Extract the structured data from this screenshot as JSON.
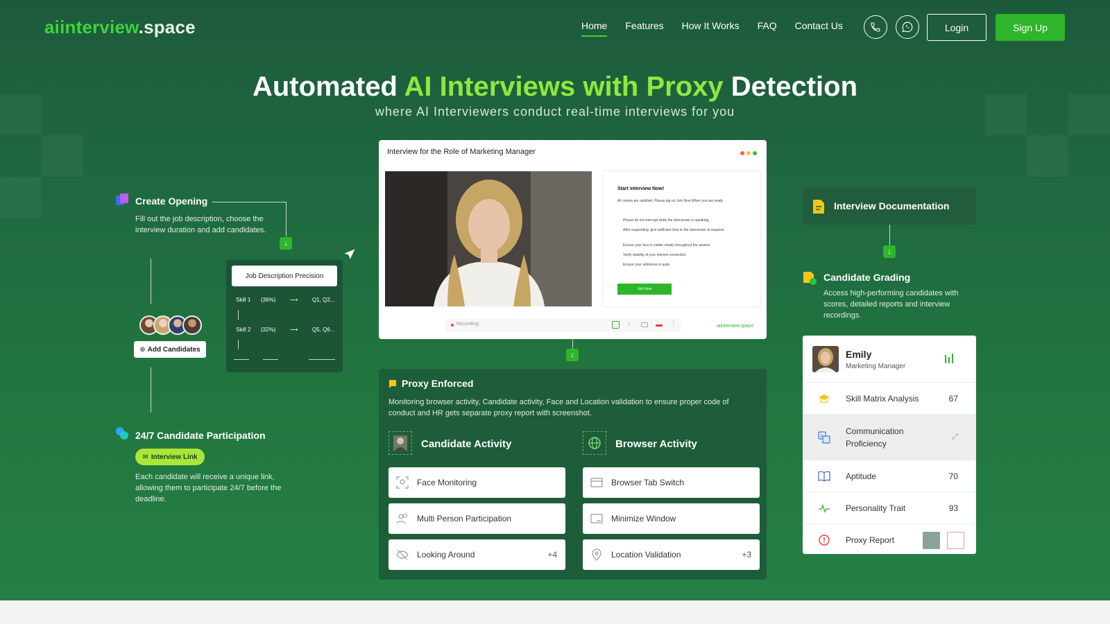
{
  "brand": {
    "logo_part1": "aiinterview",
    "logo_part2": ".space"
  },
  "nav": {
    "items": [
      "Home",
      "Features",
      "How It Works",
      "FAQ",
      "Contact Us"
    ],
    "login": "Login",
    "signup": "Sign Up"
  },
  "hero": {
    "title_part1": "Automated ",
    "title_highlight": "AI Interviews with Proxy",
    "title_part2": " Detection",
    "subtitle": "where AI Interviewers conduct real-time interviews for you"
  },
  "left": {
    "create_opening": {
      "title": "Create Opening",
      "desc": "Fill out the job description, choose the interview duration and add candidates."
    },
    "jd_card": {
      "title": "Job Description Precision",
      "rows": [
        {
          "skill": "Skill 1",
          "pct": "(36%)",
          "qs": "Q1, Q2..."
        },
        {
          "skill": "Skill 2",
          "pct": "(32%)",
          "qs": "Q5, Q6..."
        }
      ]
    },
    "add_candidates": "Add Candidates",
    "participation": {
      "title": "24/7 Candidate Participation",
      "link_label": "Interview Link",
      "desc": "Each candidate will receive a unique link, allowing them to participate 24/7 before the deadline."
    }
  },
  "interview_window": {
    "title": "Interview for the Role of Marketing Manager",
    "panel_title": "Start Interview Now!",
    "panel_intro": "All criteria are satisfied. Please tap on Join Now When you are ready.",
    "checklist": [
      "Please do not interrupt while the interviewer is speaking.",
      "After responding, give sufficient time to the interviewer to respond.",
      "Ensure your face is visible clearly throughout the session",
      "Verify stability of your internet connection",
      "Ensure your ambiance is quite"
    ],
    "join_button": "Join Now",
    "recording": "Recording",
    "watermark": "aiinterview.space"
  },
  "proxy": {
    "title": "Proxy Enforced",
    "desc": "Monitoring browser activity, Candidate activity, Face and Location validation to ensure proper code of conduct and HR gets separate proxy report with screenshot.",
    "candidate_activity": {
      "title": "Candidate Activity",
      "items": [
        {
          "label": "Face Monitoring",
          "count": ""
        },
        {
          "label": "Multi Person Participation",
          "count": ""
        },
        {
          "label": "Looking Around",
          "count": "+4"
        }
      ]
    },
    "browser_activity": {
      "title": "Browser Activity",
      "items": [
        {
          "label": "Browser Tab Switch",
          "count": ""
        },
        {
          "label": "Minimize Window",
          "count": ""
        },
        {
          "label": "Location Validation",
          "count": "+3"
        }
      ]
    }
  },
  "right": {
    "documentation": {
      "title": "Interview Documentation"
    },
    "grading": {
      "title": "Candidate Grading",
      "desc": "Access high-performing candidates with scores, detailed reports and interview recordings."
    },
    "candidate": {
      "name": "Emily",
      "role": "Marketing Manager"
    },
    "scores": [
      {
        "label": "Skill Matrix Analysis",
        "value": "67"
      },
      {
        "label": "Communication Proficiency",
        "value": ""
      },
      {
        "label": "Aptitude",
        "value": "70"
      },
      {
        "label": "Personality Trait",
        "value": "93"
      },
      {
        "label": "Proxy Report",
        "value": ""
      }
    ]
  },
  "colors": {
    "accent": "#2fb52a",
    "highlight": "#8ee83f",
    "bg_dark": "#1d5a3c"
  }
}
